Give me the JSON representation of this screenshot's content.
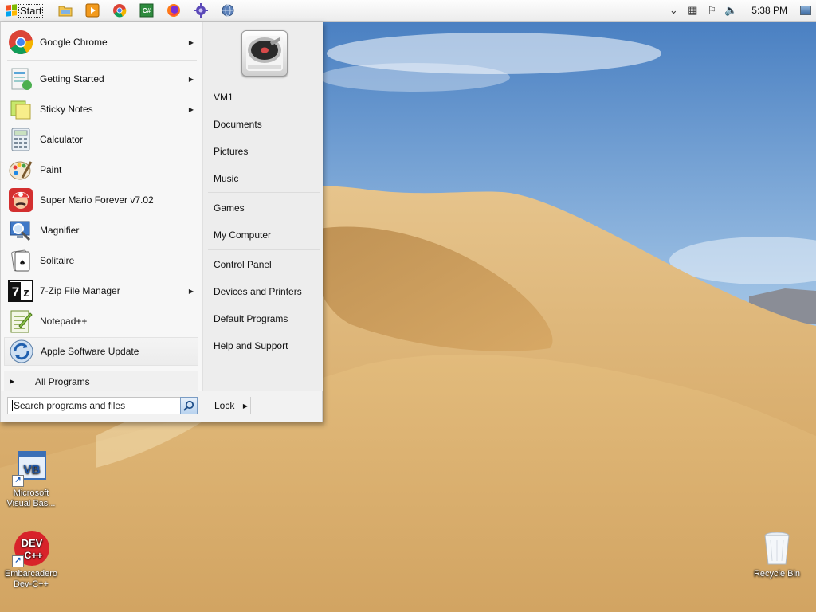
{
  "taskbar": {
    "start_label": "Start",
    "pinned": [
      {
        "name": "explorer-icon"
      },
      {
        "name": "media-player-icon"
      },
      {
        "name": "chrome-icon"
      },
      {
        "name": "calculator-program-icon"
      },
      {
        "name": "firefox-icon"
      },
      {
        "name": "settings-gear-icon"
      },
      {
        "name": "globe-icon"
      }
    ],
    "clock": "5:38 PM"
  },
  "start_menu": {
    "programs": [
      {
        "label": "Google Chrome",
        "has_submenu": true
      },
      {
        "label": "Getting Started",
        "has_submenu": true
      },
      {
        "label": "Sticky Notes",
        "has_submenu": true
      },
      {
        "label": "Calculator",
        "has_submenu": false
      },
      {
        "label": "Paint",
        "has_submenu": false
      },
      {
        "label": "Super Mario Forever v7.02",
        "has_submenu": false
      },
      {
        "label": "Magnifier",
        "has_submenu": false
      },
      {
        "label": "Solitaire",
        "has_submenu": false
      },
      {
        "label": "7-Zip File Manager",
        "has_submenu": true
      },
      {
        "label": "Notepad++",
        "has_submenu": false
      },
      {
        "label": "Apple Software Update",
        "has_submenu": false
      }
    ],
    "all_programs": "All Programs",
    "right_links": [
      "VM1",
      "Documents",
      "Pictures",
      "Music",
      "Games",
      "My Computer",
      "Control Panel",
      "Devices and Printers",
      "Default Programs",
      "Help and Support"
    ],
    "search_placeholder": "Search programs and files",
    "lock_label": "Lock"
  },
  "desktop_icons": [
    {
      "label_line1": "Microsoft",
      "label_line2": "Visual Bas..."
    },
    {
      "label_line1": "Embarcadero",
      "label_line2": "Dev-C++"
    },
    {
      "label_line1": "Recycle Bin",
      "label_line2": ""
    }
  ]
}
